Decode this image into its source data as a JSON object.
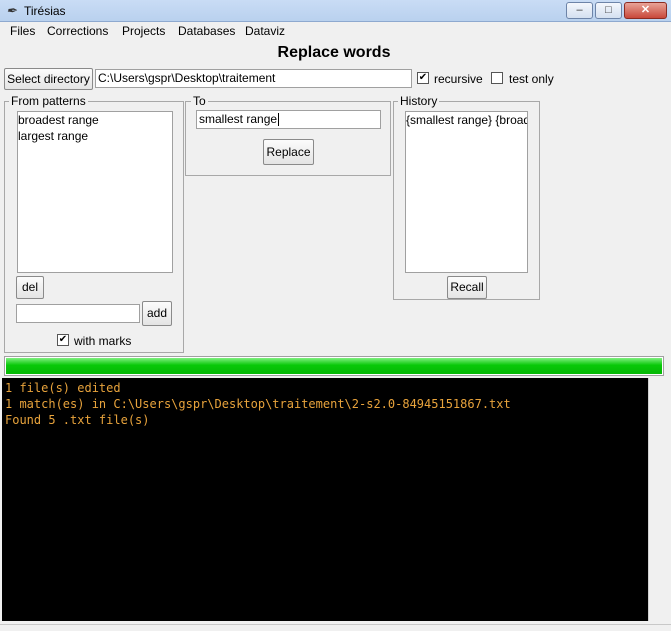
{
  "window": {
    "title": "Tirésias"
  },
  "menu": [
    "Files",
    "Corrections",
    "Projects",
    "Databases",
    "Dataviz"
  ],
  "header": {
    "title": "Replace words",
    "select_directory_label": "Select directory",
    "directory_value": "C:\\Users\\gspr\\Desktop\\traitement",
    "recursive_label": "recursive",
    "recursive_checked": true,
    "test_only_label": "test only",
    "test_only_checked": false
  },
  "from_patterns": {
    "legend": "From patterns",
    "items": [
      "broadest range",
      "largest range"
    ],
    "del_label": "del",
    "pattern_input_value": "",
    "add_label": "add",
    "with_marks_label": "with marks",
    "with_marks_checked": true
  },
  "to": {
    "legend": "To",
    "value": "smallest range",
    "replace_label": "Replace"
  },
  "history": {
    "legend": "History",
    "items": [
      "{smallest range} {broad"
    ],
    "recall_label": "Recall"
  },
  "progress": {
    "percent": 100,
    "color": "#0ac80a"
  },
  "console": {
    "text_color": "#e8a33c",
    "lines": [
      "1 file(s) edited",
      "1 match(es) in C:\\Users\\gspr\\Desktop\\traitement\\2-s2.0-84945151867.txt",
      "Found 5 .txt file(s)"
    ]
  }
}
